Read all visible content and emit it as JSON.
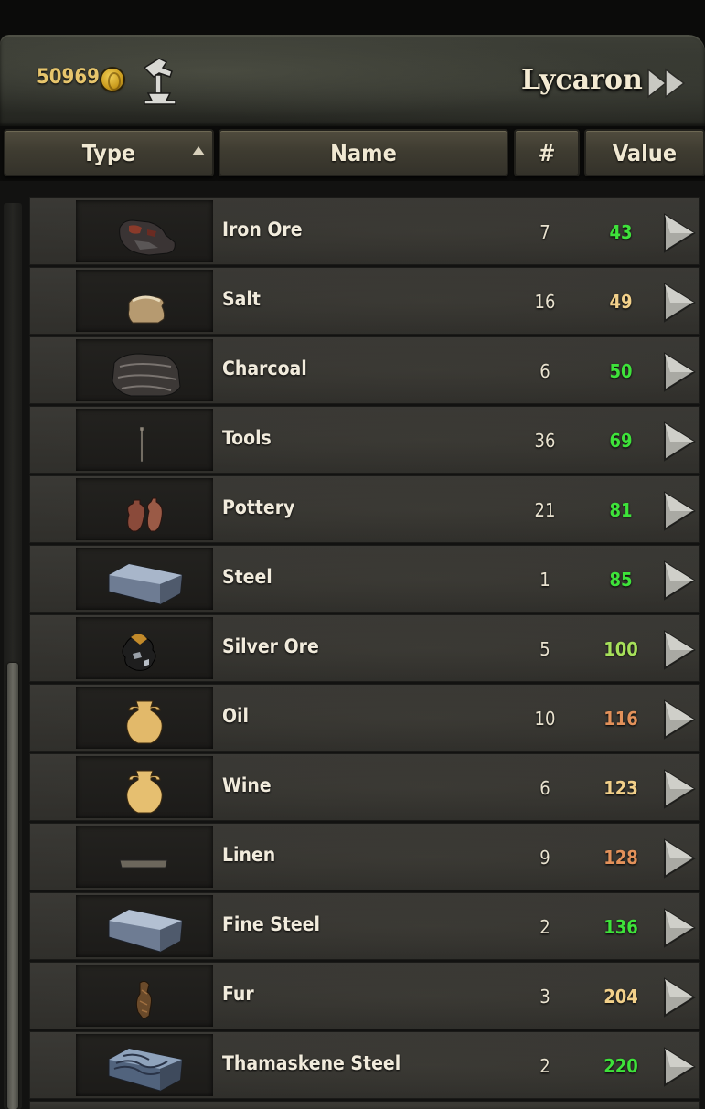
{
  "header": {
    "gold": "50969",
    "settlement": "Lycaron",
    "coin_icon": "gold-coin-icon",
    "smith_icon": "smithing-hammer-icon",
    "next_icon": "fast-forward-icon"
  },
  "columns": {
    "type": "Type",
    "name": "Name",
    "count": "#",
    "value": "Value",
    "sort": "ascending"
  },
  "colors": {
    "good": "#3ee23a",
    "fair": "#a6e05a",
    "average": "#f2d08a",
    "poor": "#e3915a"
  },
  "items": [
    {
      "name": "Iron Ore",
      "count": "7",
      "value": "43",
      "value_color": "#3ee23a",
      "icon": "iron-ore"
    },
    {
      "name": "Salt",
      "count": "16",
      "value": "49",
      "value_color": "#f2d08a",
      "icon": "salt-sack"
    },
    {
      "name": "Charcoal",
      "count": "6",
      "value": "50",
      "value_color": "#3ee23a",
      "icon": "charcoal"
    },
    {
      "name": "Tools",
      "count": "36",
      "value": "69",
      "value_color": "#3ee23a",
      "icon": "tools"
    },
    {
      "name": "Pottery",
      "count": "21",
      "value": "81",
      "value_color": "#3ee23a",
      "icon": "pottery"
    },
    {
      "name": "Steel",
      "count": "1",
      "value": "85",
      "value_color": "#3ee23a",
      "icon": "steel-ingot"
    },
    {
      "name": "Silver Ore",
      "count": "5",
      "value": "100",
      "value_color": "#a6e05a",
      "icon": "silver-ore"
    },
    {
      "name": "Oil",
      "count": "10",
      "value": "116",
      "value_color": "#e3915a",
      "icon": "oil-amphora"
    },
    {
      "name": "Wine",
      "count": "6",
      "value": "123",
      "value_color": "#f2d08a",
      "icon": "wine-amphora"
    },
    {
      "name": "Linen",
      "count": "9",
      "value": "128",
      "value_color": "#e3915a",
      "icon": "linen"
    },
    {
      "name": "Fine Steel",
      "count": "2",
      "value": "136",
      "value_color": "#3ee23a",
      "icon": "fine-steel-ingot"
    },
    {
      "name": "Fur",
      "count": "3",
      "value": "204",
      "value_color": "#f2d08a",
      "icon": "fur"
    },
    {
      "name": "Thamaskene Steel",
      "count": "2",
      "value": "220",
      "value_color": "#3ee23a",
      "icon": "thamaskene-steel-ingot"
    }
  ]
}
